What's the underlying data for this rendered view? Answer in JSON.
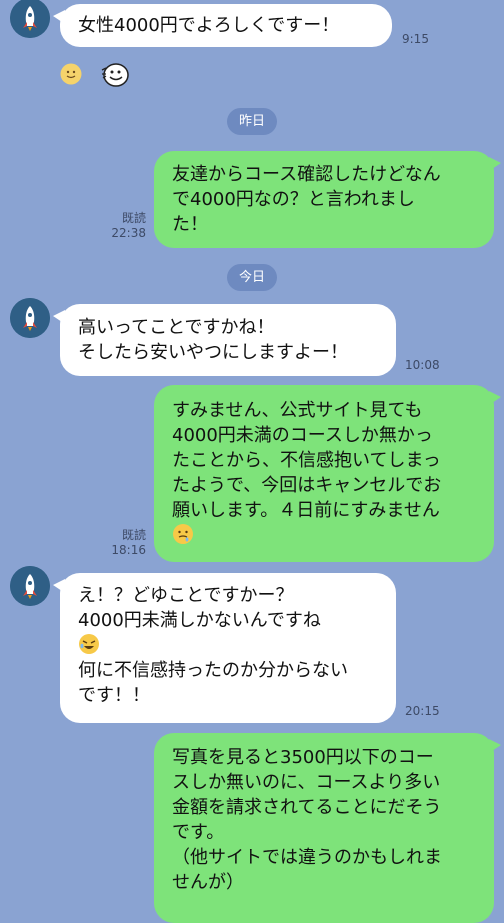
{
  "messages": [
    {
      "id": "m1",
      "dir": "in",
      "lines": [
        "女性4000円でよろしくですー！"
      ],
      "time": "9:15"
    },
    {
      "id": "m2",
      "dir": "out",
      "lines": [
        "友達からコース確認したけどなん",
        "で4000円なの？と言われまし",
        "た！"
      ],
      "read": "既読",
      "time": "22:38"
    },
    {
      "id": "m3",
      "dir": "in",
      "lines": [
        "高いってことですかね！",
        "そしたら安いやつにしますよー！"
      ],
      "time": "10:08"
    },
    {
      "id": "m4",
      "dir": "out",
      "lines": [
        "すみません、公式サイト見ても",
        "4000円未満のコースしか無かっ",
        "たことから、不信感抱いてしまっ",
        "たようで、今回はキャンセルでお",
        "願いします。４日前にすみません"
      ],
      "read": "既読",
      "time": "18:16"
    },
    {
      "id": "m5",
      "dir": "in",
      "lines": [
        "え！？どゆことですかー？",
        "4000円未満しかないんですね",
        "何に不信感持ったのか分からない",
        "です！！"
      ],
      "time": "20:15"
    },
    {
      "id": "m6",
      "dir": "out",
      "lines": [
        "写真を見ると3500円以下のコー",
        "スしか無いのに、コースより多い",
        "金額を請求されてることにだそう",
        "です。",
        "（他サイトでは違うのかもしれま",
        "せんが）"
      ]
    }
  ],
  "dates": {
    "yesterday": "昨日",
    "today": "今日"
  },
  "icons": {
    "avatar": "rocket-avatar",
    "emoji_smile": "smile-emoji",
    "emoji_sticker": "face-sticker",
    "emoji_grimace": "grimacing-emoji",
    "emoji_rofl": "rofl-emoji"
  },
  "colors": {
    "background": "#8aa3d2",
    "outgoing": "#7ee37a",
    "incoming": "#ffffff",
    "avatar": "#2f5f86"
  }
}
